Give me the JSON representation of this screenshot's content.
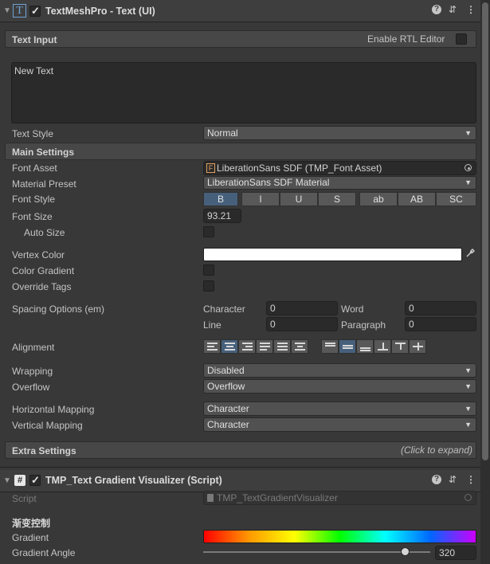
{
  "component1": {
    "title": "TextMeshPro - Text (UI)",
    "icon_glyph": "T",
    "help_glyph": "?",
    "settings_glyph": "⇵",
    "menu_glyph": "⋮",
    "text_input": {
      "label": "Text Input",
      "rtl_label": "Enable RTL Editor",
      "value": "New Text"
    },
    "text_style": {
      "label": "Text Style",
      "value": "Normal"
    },
    "main_settings": {
      "label": "Main Settings",
      "font_asset": {
        "label": "Font Asset",
        "value": "LiberationSans SDF (TMP_Font Asset)",
        "icon": "F"
      },
      "material_preset": {
        "label": "Material Preset",
        "value": "LiberationSans SDF Material"
      },
      "font_style": {
        "label": "Font Style",
        "buttons": [
          "B",
          "I",
          "U",
          "S",
          "ab",
          "AB",
          "SC"
        ]
      },
      "font_size": {
        "label": "Font Size",
        "value": "93.21"
      },
      "auto_size": {
        "label": "Auto Size"
      },
      "vertex_color": {
        "label": "Vertex Color",
        "color": "#ffffff"
      },
      "color_gradient": {
        "label": "Color Gradient"
      },
      "override_tags": {
        "label": "Override Tags"
      },
      "spacing": {
        "label": "Spacing Options (em)",
        "character_label": "Character",
        "character_value": "0",
        "word_label": "Word",
        "word_value": "0",
        "line_label": "Line",
        "line_value": "0",
        "paragraph_label": "Paragraph",
        "paragraph_value": "0"
      },
      "alignment": {
        "label": "Alignment"
      },
      "wrapping": {
        "label": "Wrapping",
        "value": "Disabled"
      },
      "overflow": {
        "label": "Overflow",
        "value": "Overflow"
      },
      "horizontal_mapping": {
        "label": "Horizontal Mapping",
        "value": "Character"
      },
      "vertical_mapping": {
        "label": "Vertical Mapping",
        "value": "Character"
      }
    },
    "extra_settings": {
      "label": "Extra Settings",
      "hint": "(Click to expand)"
    }
  },
  "component2": {
    "title": "TMP_Text Gradient Visualizer (Script)",
    "icon_glyph": "#",
    "script": {
      "label": "Script",
      "value": "TMP_TextGradientVisualizer"
    },
    "section_header": "渐变控制",
    "gradient": {
      "label": "Gradient"
    },
    "gradient_angle": {
      "label": "Gradient Angle",
      "value": "320",
      "slider_fraction": 0.89,
      "max": 360
    }
  },
  "colors": {
    "accent_selected": "#46607c",
    "gradient_stops": [
      "#ff0000",
      "#ff9900",
      "#ffff00",
      "#00ff00",
      "#00ffff",
      "#0066ff",
      "#cc00ff"
    ]
  }
}
